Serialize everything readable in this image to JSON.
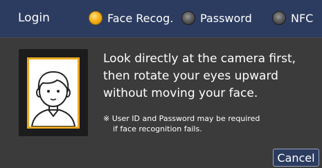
{
  "header": {
    "title": "Login",
    "options": [
      {
        "label": "Face Recog.",
        "selected": true
      },
      {
        "label": "Password",
        "selected": false
      },
      {
        "label": "NFC",
        "selected": false
      }
    ]
  },
  "instructions": {
    "lines": [
      "Look directly at the camera first,",
      "then rotate your eyes upward",
      "without moving your face."
    ]
  },
  "note": {
    "lines": [
      "※ User ID and Password may be required",
      "if face recognition fails."
    ]
  },
  "buttons": {
    "cancel": "Cancel"
  },
  "icons": {
    "face": "face-outline-icon",
    "radio_on": "radio-selected-icon",
    "radio_off": "radio-unselected-icon"
  },
  "colors": {
    "header": "#2c3c60",
    "background": "#3b3b3b",
    "accent": "#e9a820",
    "text": "#ffffff"
  }
}
